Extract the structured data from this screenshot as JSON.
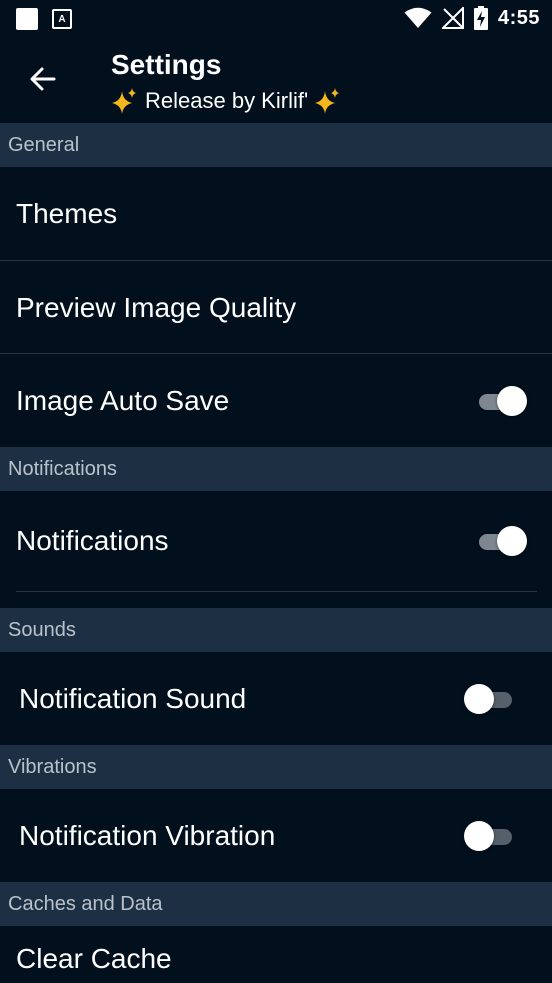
{
  "status_bar": {
    "time": "4:55"
  },
  "app_bar": {
    "title": "Settings",
    "subtitle": "Release by Kirlif'"
  },
  "sections": {
    "general": {
      "header": "General",
      "themes": "Themes",
      "preview_quality": "Preview Image Quality",
      "image_auto_save": {
        "label": "Image Auto Save",
        "on": true
      }
    },
    "notifications": {
      "header": "Notifications",
      "notifications": {
        "label": "Notifications",
        "on": true
      }
    },
    "sounds": {
      "header": "Sounds",
      "notification_sound": {
        "label": "Notification Sound",
        "on": false
      }
    },
    "vibrations": {
      "header": "Vibrations",
      "notification_vibration": {
        "label": "Notification Vibration",
        "on": false
      }
    },
    "caches": {
      "header": "Caches and Data",
      "clear_cache": "Clear Cache"
    }
  },
  "colors": {
    "background": "#02101e",
    "section_header": "#1d3043",
    "header_text": "#b9c2cb",
    "sparkle": "#f5b81c"
  },
  "icons": [
    "square-notification-icon",
    "font-notification-icon",
    "wifi-icon",
    "no-signal-icon",
    "battery-charging-icon",
    "back-arrow-icon",
    "sparkles-icon"
  ]
}
